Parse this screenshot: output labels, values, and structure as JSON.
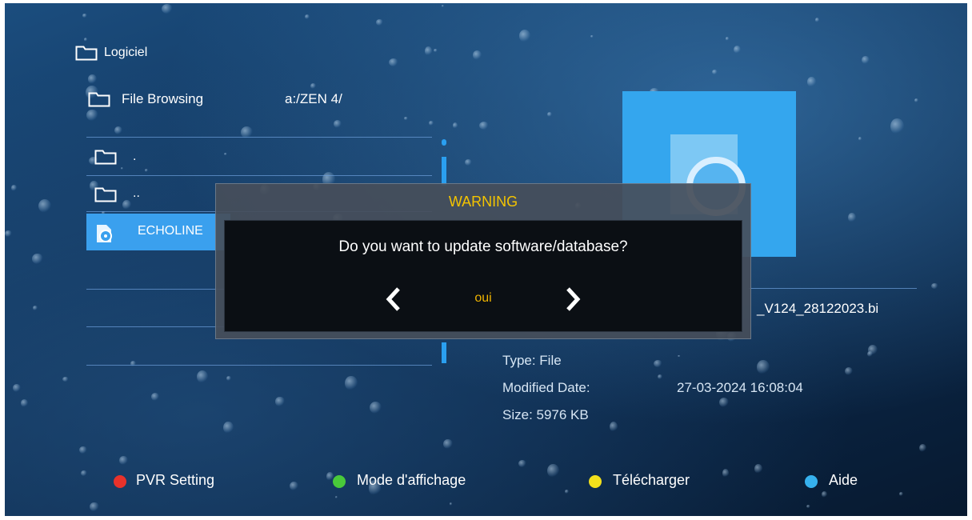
{
  "breadcrumb": {
    "root_label": "Logiciel",
    "section_label": "File Browsing",
    "path": "a:/ZEN 4/"
  },
  "file_list": {
    "items": [
      {
        "label": ".",
        "icon": "folder-icon"
      },
      {
        "label": "..",
        "icon": "folder-icon"
      },
      {
        "label": "ECHOLINE",
        "icon": "disc-file-icon",
        "selected": true
      }
    ]
  },
  "file_info": {
    "filename_visible": "_V124_28122023.bi",
    "type_label": "Type: File",
    "modified_label": "Modified Date:",
    "modified_value": "27-03-2024 16:08:04",
    "size_label": "Size: 5976 KB"
  },
  "dialog": {
    "title": "WARNING",
    "message": "Do you want to update software/database?",
    "option": "oui"
  },
  "legend": [
    {
      "label": "PVR Setting",
      "color": "#e8322b"
    },
    {
      "label": "Mode d'affichage",
      "color": "#49c93a"
    },
    {
      "label": "Télécharger",
      "color": "#f2e01c"
    },
    {
      "label": "Aide",
      "color": "#36b1ee"
    }
  ],
  "colors": {
    "accent": "#3aa0ee",
    "warning_title": "#f4c400",
    "option": "#f0b400"
  }
}
